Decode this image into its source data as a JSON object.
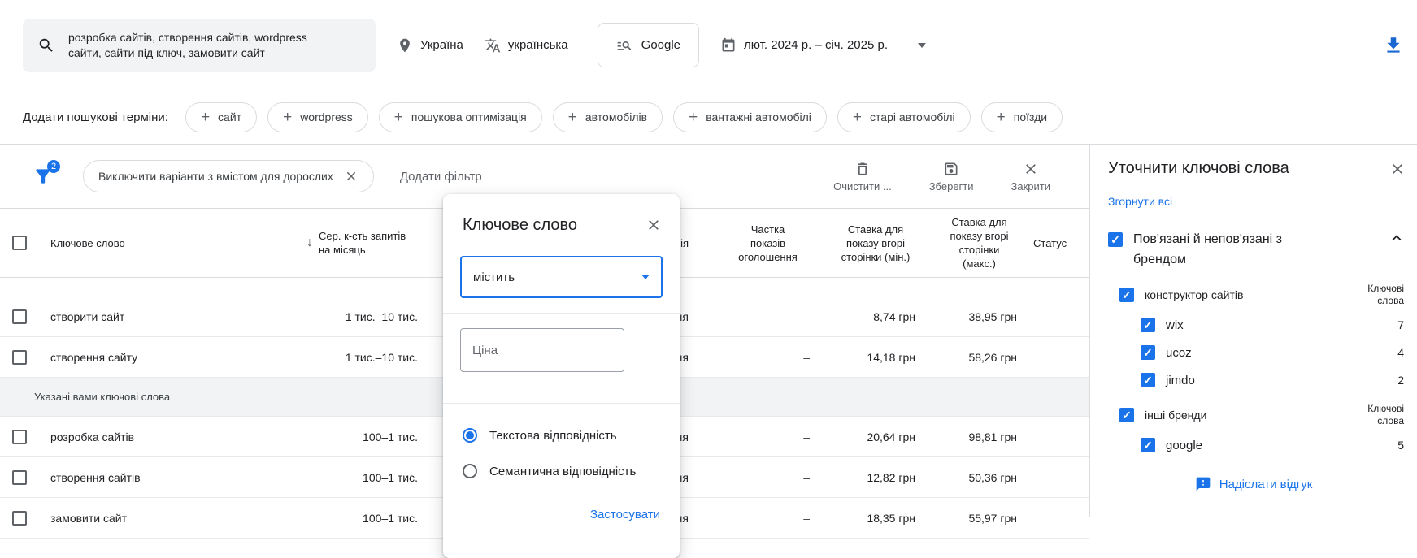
{
  "topbar": {
    "search_value": "розробка сайтів, створення сайтів, wordpress сайти, сайти під ключ, замовити сайт",
    "location": "Україна",
    "language": "українська",
    "network": "Google",
    "date_range": "лют. 2024 р. – січ. 2025 р."
  },
  "add_terms": {
    "label": "Додати пошукові терміни:",
    "chips": [
      "сайт",
      "wordpress",
      "пошукова оптимізація",
      "автомобілів",
      "вантажні автомобілі",
      "старі автомобілі",
      "поїзди"
    ]
  },
  "filter_bar": {
    "badge": "2",
    "filter_chip": "Виключити варіанти з вмістом для дорослих",
    "add_filter": "Додати фільтр",
    "clear": "Очистити ...",
    "save": "Зберегти",
    "close": "Закрити"
  },
  "table": {
    "sort_arrow": "↓",
    "col_keyword": "Ключове слово",
    "col_avg": "Сер. к-сть запитів на місяць",
    "col_competition": "Конкуренція",
    "col_share": "Частка показів оголошення",
    "col_bid_min": "Ставка для показу вгорі сторінки (мін.)",
    "col_bid_max": "Ставка для показу вгорі сторінки (макс.)",
    "col_status": "Статус",
    "section_label": "Указані вами ключові слова",
    "rows": [
      {
        "keyword": "створити сайт",
        "avg": "1 тис.–10 тис.",
        "competition": "Середня",
        "share": "–",
        "bid_min": "8,74 грн",
        "bid_max": "38,95 грн"
      },
      {
        "keyword": "створення сайту",
        "avg": "1 тис.–10 тис.",
        "competition": "Середня",
        "share": "–",
        "bid_min": "14,18 грн",
        "bid_max": "58,26 грн"
      },
      {
        "keyword": "розробка сайтів",
        "avg": "100–1 тис.",
        "competition": "Середня",
        "share": "–",
        "bid_min": "20,64 грн",
        "bid_max": "98,81 грн"
      },
      {
        "keyword": "створення сайтів",
        "avg": "100–1 тис.",
        "competition": "Середня",
        "share": "–",
        "bid_min": "12,82 грн",
        "bid_max": "50,36 грн"
      },
      {
        "keyword": "замовити сайт",
        "avg": "100–1 тис.",
        "competition": "Середня",
        "share": "–",
        "bid_min": "18,35 грн",
        "bid_max": "55,97 грн"
      }
    ]
  },
  "modal": {
    "title": "Ключове слово",
    "operator": "містить",
    "value_placeholder": "Ціна",
    "option_text": "Текстова відповідність",
    "option_semantic": "Семантична відповідність",
    "apply": "Застосувати"
  },
  "panel": {
    "title": "Уточнити ключові слова",
    "collapse_all": "Згорнути всі",
    "group_title": "Пов'язані й непов'язані з брендом",
    "count_header": "Ключові слова",
    "subgroup1_label": "конструктор сайтів",
    "subgroup2_label": "інші бренди",
    "items1": [
      {
        "label": "wix",
        "count": "7"
      },
      {
        "label": "ucoz",
        "count": "4"
      },
      {
        "label": "jimdo",
        "count": "2"
      }
    ],
    "items2": [
      {
        "label": "google",
        "count": "5"
      }
    ],
    "feedback": "Надіслати відгук"
  },
  "colors": {
    "accent": "#1a73e8"
  }
}
